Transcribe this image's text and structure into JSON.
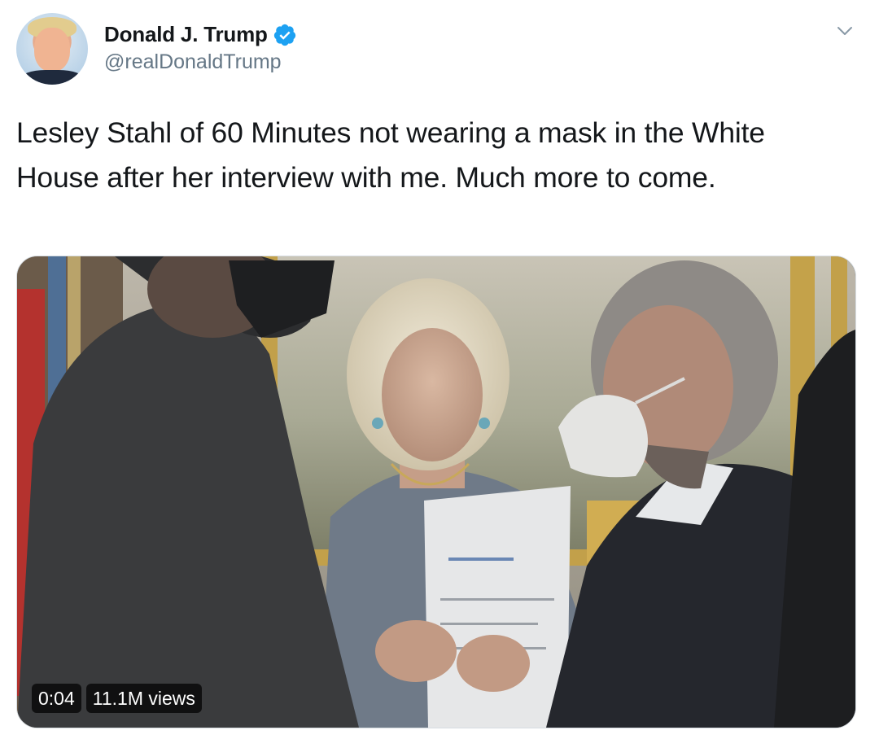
{
  "user": {
    "display_name": "Donald J. Trump",
    "handle": "@realDonaldTrump",
    "verified": true
  },
  "tweet": {
    "text": "Lesley Stahl of 60 Minutes not wearing a mask in the White House after her interview with me. Much more to come."
  },
  "video": {
    "duration": "0:04",
    "views": "11.1M views"
  },
  "icons": {
    "verified": "verified-badge-icon",
    "menu": "chevron-down-icon"
  },
  "colors": {
    "accent": "#1da1f2",
    "text": "#14171a",
    "secondary": "#657786"
  }
}
